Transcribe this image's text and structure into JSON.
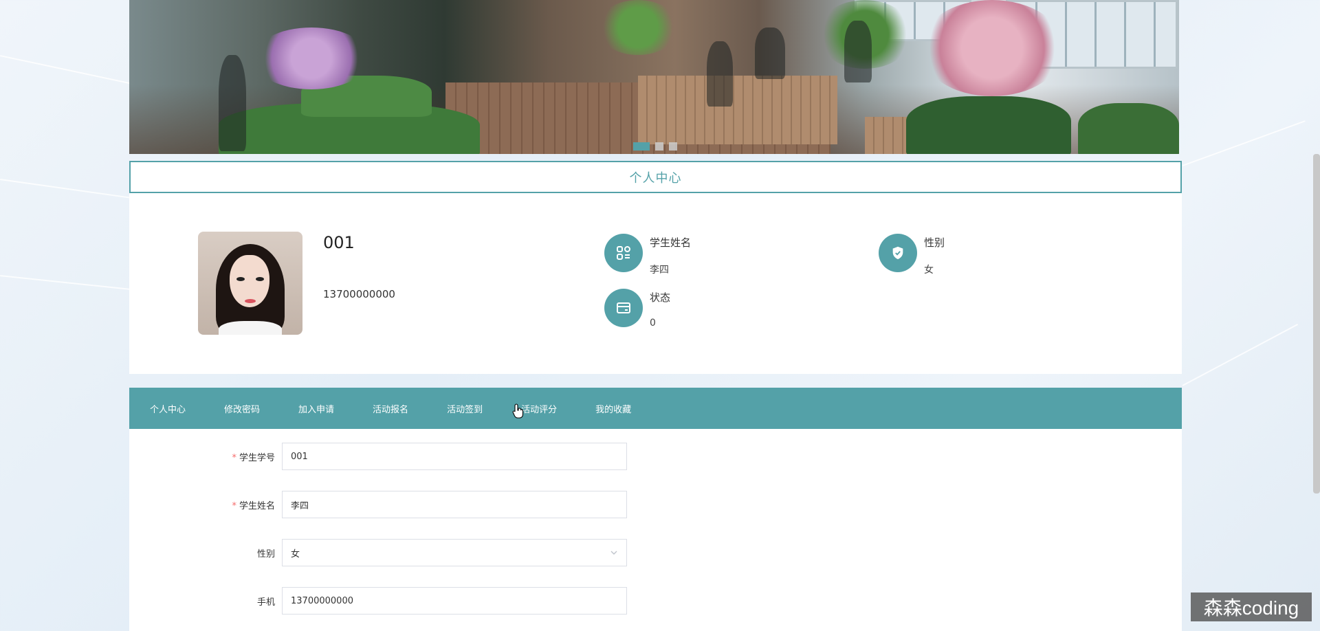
{
  "banner": {
    "slide_count": 3,
    "active_slide": 1
  },
  "section": {
    "title": "个人中心"
  },
  "profile": {
    "id": "001",
    "phone": "13700000000",
    "fields": [
      {
        "label": "学生姓名",
        "value": "李四",
        "icon": "apps-icon"
      },
      {
        "label": "性别",
        "value": "女",
        "icon": "shield-icon"
      },
      {
        "label": "状态",
        "value": "0",
        "icon": "wallet-icon"
      }
    ]
  },
  "tabs": [
    {
      "label": "个人中心"
    },
    {
      "label": "修改密码"
    },
    {
      "label": "加入申请"
    },
    {
      "label": "活动报名"
    },
    {
      "label": "活动签到"
    },
    {
      "label": "活动评分"
    },
    {
      "label": "我的收藏"
    }
  ],
  "form": {
    "student_id": {
      "label": "学生学号",
      "value": "001",
      "required": true
    },
    "student_name": {
      "label": "学生姓名",
      "value": "李四",
      "required": true
    },
    "gender": {
      "label": "性别",
      "value": "女"
    },
    "phone": {
      "label": "手机",
      "value": "13700000000"
    }
  },
  "watermark": "森森coding",
  "colors": {
    "accent": "#54a1a8",
    "required": "#f56c6c"
  }
}
